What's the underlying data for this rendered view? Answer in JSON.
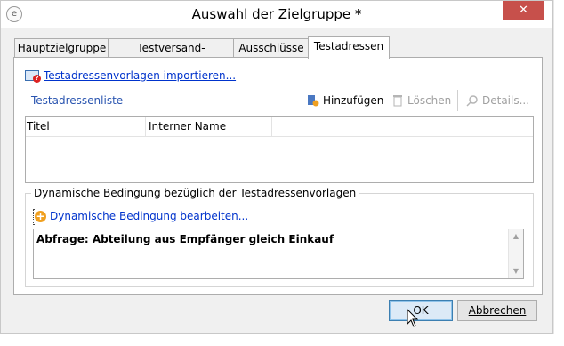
{
  "window": {
    "title": "Auswahl der Zielgruppe *",
    "close_glyph": "✕",
    "app_icon": "app-icon"
  },
  "tabs": [
    {
      "label": "Hauptzielgruppe",
      "active": false
    },
    {
      "label": "Testversand-Zielgruppe",
      "active": false
    },
    {
      "label": "Ausschlüsse",
      "active": false
    },
    {
      "label": "Testadressen",
      "active": true
    }
  ],
  "panel": {
    "import_link": "Testadressenvorlagen importieren...",
    "list_title": "Testadressenliste",
    "toolbar": {
      "add": "Hinzufügen",
      "delete": "Löschen",
      "details": "Details..."
    },
    "list": {
      "columns": [
        "Titel",
        "Interner Name"
      ],
      "rows": []
    },
    "dynamic": {
      "group_title": "Dynamische Bedingung bezüglich der Testadressenvorlagen",
      "edit_link": "Dynamische Bedingung bearbeiten...",
      "query_text": "Abfrage: Abteilung aus Empfänger gleich Einkauf"
    }
  },
  "buttons": {
    "ok": "OK",
    "cancel": "Abbrechen"
  },
  "colors": {
    "link": "#0033cc",
    "section_label": "#2a55b0",
    "close_button": "#c7504b"
  }
}
